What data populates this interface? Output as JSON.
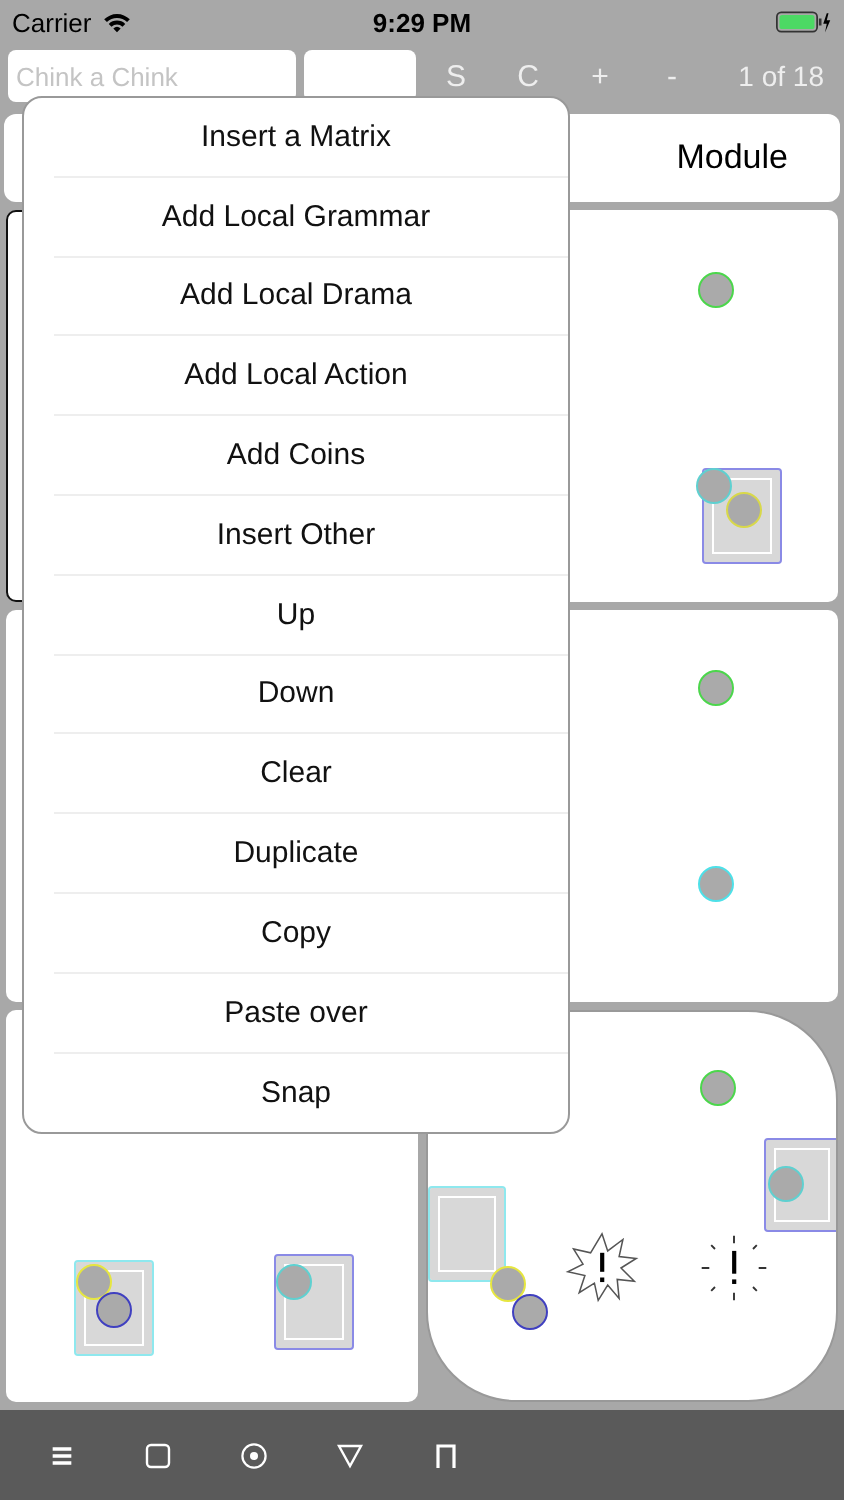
{
  "status_bar": {
    "carrier": "Carrier",
    "time": "9:29 PM"
  },
  "toolbar": {
    "search": {
      "placeholder": "Chink a Chink"
    },
    "buttons": [
      "S",
      "C",
      "+",
      "-"
    ],
    "page": "1 of 18"
  },
  "header": {
    "title": "Module"
  },
  "cards": [
    {
      "selected": true
    },
    {
      "selected": false
    },
    {
      "selected": false
    },
    {
      "selected": false
    },
    {
      "selected": false
    },
    {
      "selected": false
    }
  ],
  "menu": [
    {
      "label": "Insert a Matrix"
    },
    {
      "label": "Add Local Grammar"
    },
    {
      "label": "Add Local Drama"
    },
    {
      "label": "Add Local Action"
    },
    {
      "label": "Add Coins"
    },
    {
      "label": "Insert Other"
    },
    {
      "label": "Up"
    },
    {
      "label": "Down"
    },
    {
      "label": "Clear"
    },
    {
      "label": "Duplicate"
    },
    {
      "label": "Copy"
    },
    {
      "label": "Paste over"
    },
    {
      "label": "Snap"
    }
  ]
}
